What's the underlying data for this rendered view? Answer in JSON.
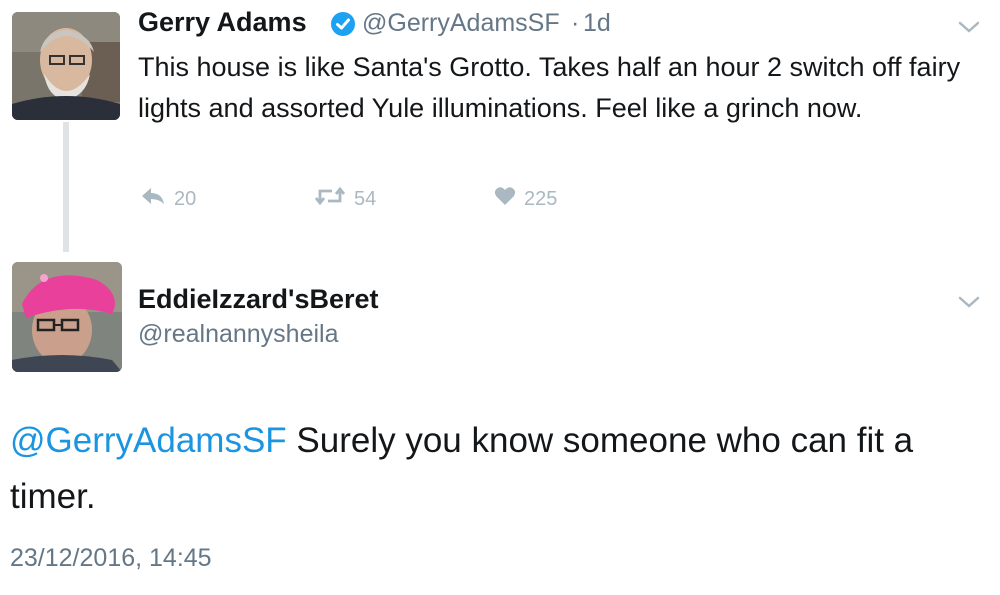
{
  "original_tweet": {
    "author_name": "Gerry Adams",
    "handle": "@GerryAdamsSF",
    "separator": "·",
    "time": "1d",
    "verified": true,
    "text": "This house is like Santa's Grotto. Takes half an hour 2 switch off fairy lights and assorted Yule illuminations. Feel like a grinch now.",
    "reply_count": "20",
    "retweet_count": "54",
    "like_count": "225"
  },
  "reply_tweet": {
    "author_name": "EddieIzzard'sBeret",
    "handle": "@realnannysheila",
    "mention": "@GerryAdamsSF",
    "text": " Surely you know someone who can fit a timer.",
    "timestamp": "23/12/2016, 14:45"
  },
  "colors": {
    "link": "#1b95e0",
    "secondary_text": "#657786",
    "action_icon": "#aab8c2",
    "verified_badge": "#1da1f2",
    "thread_line": "#dfe3e6"
  },
  "icons": {
    "reply": "reply-icon",
    "retweet": "retweet-icon",
    "like": "heart-icon",
    "menu": "chevron-down-icon",
    "verified": "verified-badge-icon"
  }
}
